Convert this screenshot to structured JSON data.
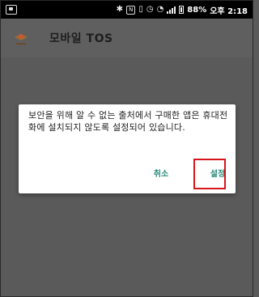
{
  "status_bar": {
    "battery": "88%",
    "time": "오후 2:18",
    "icons": [
      "app-notification-icon",
      "bluetooth-icon",
      "nfc-icon",
      "vibrate-icon",
      "alarm-icon",
      "wifi-icon",
      "signal-icon",
      "battery-icon"
    ]
  },
  "app_bar": {
    "title": "모바일 TOS",
    "logo": "app-logo-icon"
  },
  "dialog": {
    "message": "보안을 위해 알 수 없는 출처에서 구매한 앱은 휴대전화에 설치되지 않도록 설정되어 있습니다.",
    "cancel_label": "취소",
    "ok_label": "설정",
    "button_color": "#2a8a7a",
    "highlight_color": "#d8141b"
  }
}
